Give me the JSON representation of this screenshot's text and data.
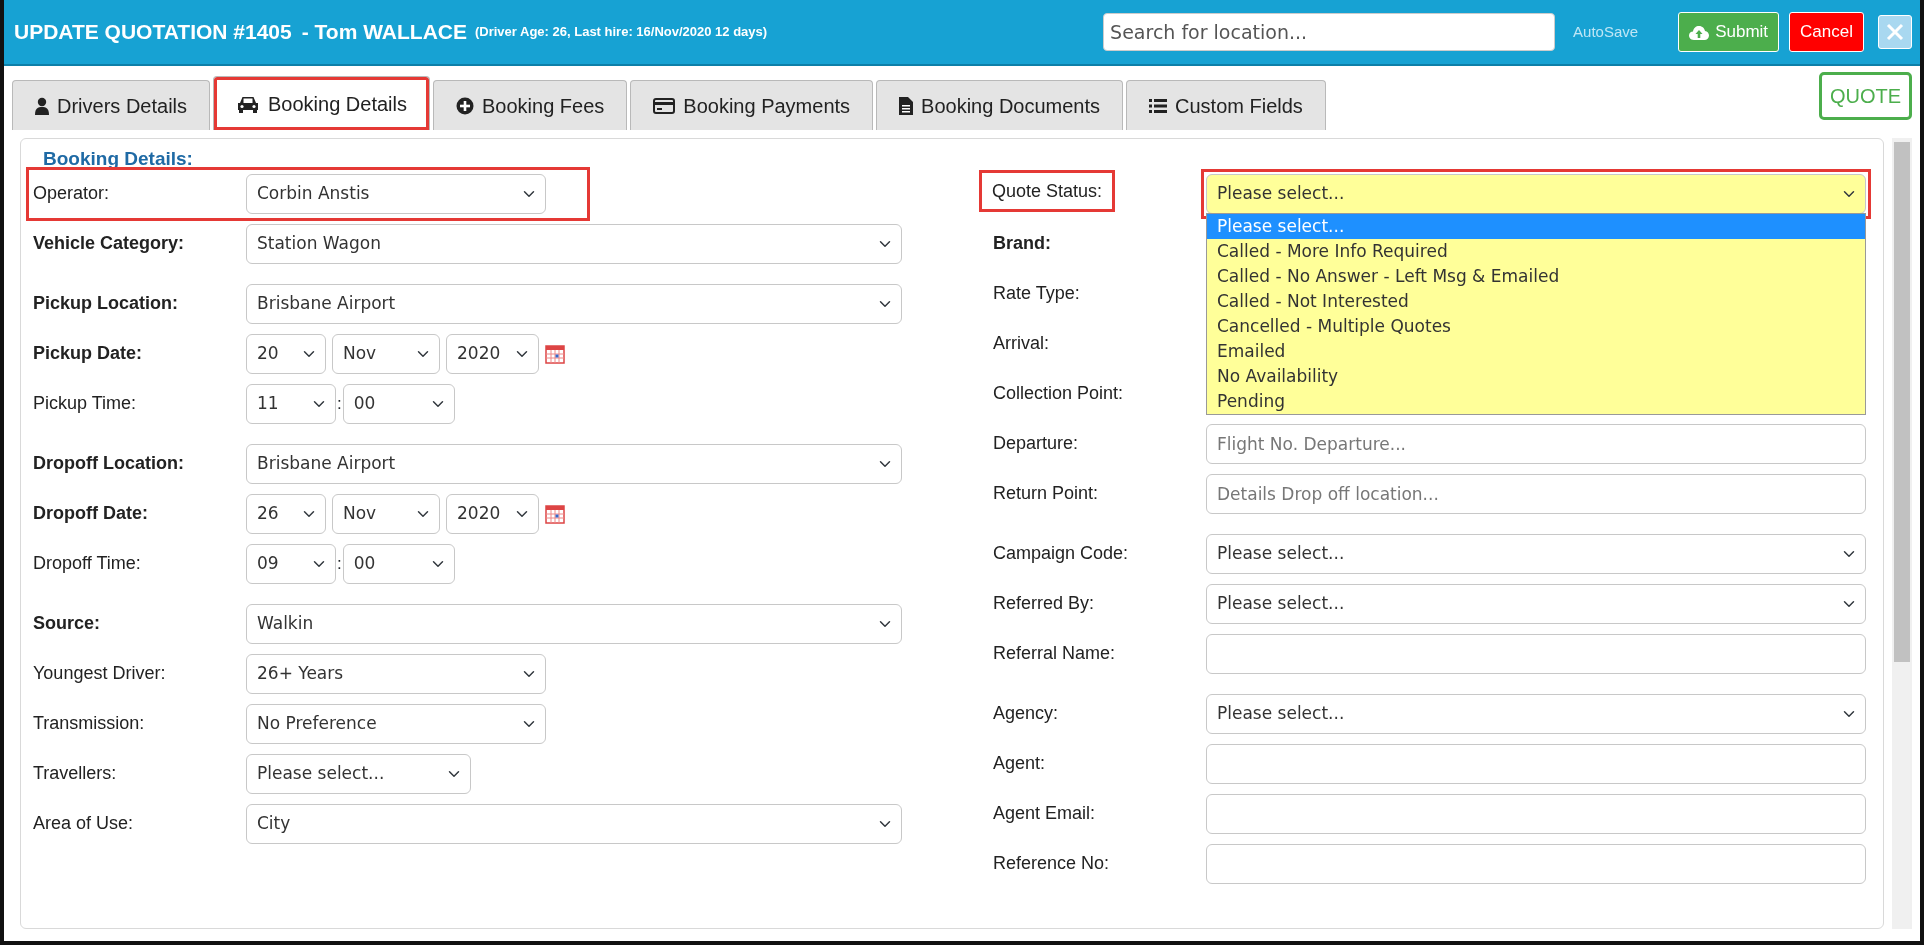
{
  "header": {
    "title": "UPDATE QUOTATION #1405",
    "customer": "- Tom WALLACE",
    "driver_info": "(Driver Age: 26, Last hire: 16/Nov/2020 12 days)",
    "search": {
      "placeholder": "Search for location..."
    },
    "autosave": "AutoSave",
    "buttons": [
      {
        "kind": "submit",
        "label": "Submit"
      },
      {
        "kind": "cancel",
        "label": "Cancel"
      },
      {
        "kind": "close"
      }
    ]
  },
  "tabs": [
    {
      "label": "Drivers Details",
      "kind": "person",
      "selected": false,
      "highlighted": false
    },
    {
      "label": "Booking Details",
      "kind": "car",
      "selected": true,
      "highlighted": true
    },
    {
      "label": "Booking Fees",
      "kind": "plus",
      "selected": false,
      "highlighted": false
    },
    {
      "label": "Booking Payments",
      "kind": "card",
      "selected": false,
      "highlighted": false
    },
    {
      "label": "Booking Documents",
      "kind": "document",
      "selected": false,
      "highlighted": false
    },
    {
      "label": "Custom Fields",
      "kind": "list",
      "selected": false,
      "highlighted": false
    }
  ],
  "status_badge": "QUOTE",
  "section_title": "Booking Details:",
  "left_sections": [
    [
      {
        "label": "Operator:",
        "bold": false,
        "kind": "narrow_select",
        "value": "Corbin Anstis",
        "highlighted": true
      },
      {
        "label": "Vehicle Category:",
        "bold": true,
        "kind": "select",
        "value": "Station Wagon",
        "highlighted": false
      }
    ],
    [
      {
        "label": "Pickup Location:",
        "bold": true,
        "kind": "select",
        "value": "Brisbane Airport",
        "highlighted": false
      },
      {
        "label": "Pickup Date:",
        "bold": true,
        "kind": "date",
        "parts": [
          "20",
          "Nov",
          "2020"
        ],
        "highlighted": false
      },
      {
        "label": "Pickup Time:",
        "bold": false,
        "kind": "time",
        "parts": [
          "11",
          "00"
        ],
        "separator": ":",
        "highlighted": false
      }
    ],
    [
      {
        "label": "Dropoff Location:",
        "bold": true,
        "kind": "select",
        "value": "Brisbane Airport",
        "highlighted": false
      },
      {
        "label": "Dropoff Date:",
        "bold": true,
        "kind": "date",
        "parts": [
          "26",
          "Nov",
          "2020"
        ],
        "highlighted": false
      },
      {
        "label": "Dropoff Time:",
        "bold": false,
        "kind": "time",
        "parts": [
          "09",
          "00"
        ],
        "separator": ":",
        "highlighted": false
      }
    ],
    [
      {
        "label": "Source:",
        "bold": true,
        "kind": "select",
        "value": "Walkin",
        "highlighted": false
      },
      {
        "label": "Youngest Driver:",
        "bold": false,
        "kind": "narrow_select",
        "value": "26+ Years",
        "highlighted": false
      },
      {
        "label": "Transmission:",
        "bold": false,
        "kind": "narrow_select",
        "value": "No Preference",
        "highlighted": false
      },
      {
        "label": "Travellers:",
        "bold": false,
        "kind": "compact_select",
        "value": "Please select...",
        "highlighted": false
      },
      {
        "label": "Area of Use:",
        "bold": false,
        "kind": "select",
        "value": "City",
        "highlighted": false
      }
    ]
  ],
  "right_sections": [
    [
      {
        "label": "Quote Status:",
        "bold": false,
        "kind": "status_select",
        "value": "Please select...",
        "highlighted": true,
        "options": [
          {
            "label": "Please select...",
            "selected": true
          },
          {
            "label": "Called - More Info Required",
            "selected": false
          },
          {
            "label": "Called - No Answer - Left Msg & Emailed",
            "selected": false
          },
          {
            "label": "Called - Not Interested",
            "selected": false
          },
          {
            "label": "Cancelled - Multiple Quotes",
            "selected": false
          },
          {
            "label": "Emailed",
            "selected": false
          },
          {
            "label": "No Availability",
            "selected": false
          },
          {
            "label": "Pending",
            "selected": false
          }
        ]
      },
      {
        "label": "Brand:",
        "bold": true,
        "kind": "covered",
        "highlighted": false
      },
      {
        "label": "Rate Type:",
        "bold": false,
        "kind": "covered",
        "highlighted": false
      },
      {
        "label": "Arrival:",
        "bold": false,
        "kind": "covered",
        "highlighted": false
      },
      {
        "label": "Collection Point:",
        "bold": false,
        "kind": "covered",
        "highlighted": false
      },
      {
        "label": "Departure:",
        "bold": false,
        "kind": "input",
        "placeholder": "Flight No. Departure...",
        "highlighted": false
      },
      {
        "label": "Return Point:",
        "bold": false,
        "kind": "input",
        "placeholder": "Details Drop off location...",
        "highlighted": false
      }
    ],
    [
      {
        "label": "Campaign Code:",
        "bold": false,
        "kind": "select",
        "value": "Please select...",
        "highlighted": false
      },
      {
        "label": "Referred By:",
        "bold": false,
        "kind": "select",
        "value": "Please select...",
        "highlighted": false
      },
      {
        "label": "Referral Name:",
        "bold": false,
        "kind": "input",
        "highlighted": false
      }
    ],
    [
      {
        "label": "Agency:",
        "bold": false,
        "kind": "select",
        "value": "Please select...",
        "highlighted": false
      },
      {
        "label": "Agent:",
        "bold": false,
        "kind": "input",
        "highlighted": false
      },
      {
        "label": "Agent Email:",
        "bold": false,
        "kind": "input",
        "highlighted": false
      },
      {
        "label": "Reference No:",
        "bold": false,
        "kind": "input",
        "highlighted": false
      }
    ]
  ]
}
